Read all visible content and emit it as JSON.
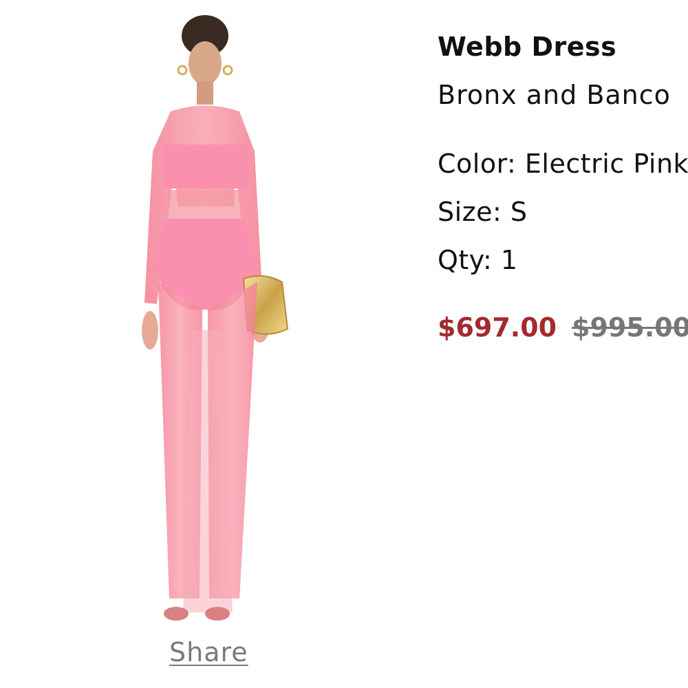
{
  "product": {
    "title": "Webb Dress",
    "brand": "Bronx and Banco",
    "color_label": "Color: Electric Pink",
    "size_label": "Size: S",
    "qty_label": "Qty: 1",
    "sale_price": "$697.00",
    "original_price": "$995.00",
    "image_icon": "product-photo-model-icon"
  },
  "actions": {
    "share_label": "Share"
  },
  "colors": {
    "sale_price": "#a32a2e",
    "original_price": "#777777",
    "share": "#7a7a7a",
    "garment_pink": "#f57a93"
  }
}
